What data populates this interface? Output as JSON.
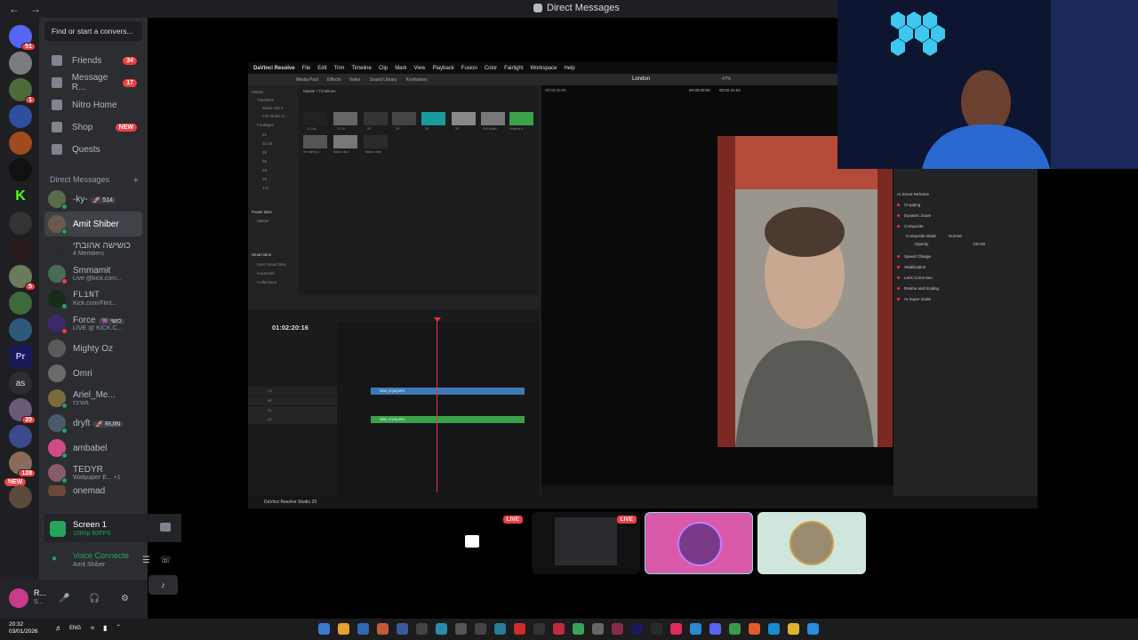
{
  "window": {
    "title": "Direct Messages"
  },
  "rail": {
    "badges": [
      "51",
      "1",
      "5",
      "20",
      "128"
    ],
    "labels": {
      "premiere": "Pr",
      "as": "as",
      "k": "K"
    },
    "new_label": "NEW"
  },
  "search": {
    "placeholder": "Find or start a convers..."
  },
  "nav": {
    "friends": {
      "label": "Friends",
      "count": "34"
    },
    "requests": {
      "label": "Message R...",
      "count": "17"
    },
    "nitro": {
      "label": "Nitro Home"
    },
    "shop": {
      "label": "Shop",
      "badge": "NEW"
    },
    "quests": {
      "label": "Quests"
    }
  },
  "dm_header": {
    "label": "Direct Messages",
    "add": "+"
  },
  "dms": [
    {
      "name": "-ky-",
      "tag": "🚀 514",
      "sub": ""
    },
    {
      "name": "Amit Shiber",
      "tag": "",
      "sub": ""
    },
    {
      "name": "כושישה אהובתי",
      "tag": "",
      "sub": "4 Members"
    },
    {
      "name": "Smmamit",
      "tag": "",
      "sub": "Live @kick.com..."
    },
    {
      "name": "FLiNT",
      "tag": "",
      "sub": "Kick.com/Flint..."
    },
    {
      "name": "Force",
      "tag": "👾 כושי",
      "sub": "LIVE @ KICK.C..."
    },
    {
      "name": "Mighty Oz",
      "tag": "",
      "sub": ""
    },
    {
      "name": "Omri",
      "tag": "",
      "sub": ""
    },
    {
      "name": "Ariel_Me...",
      "tag": "",
      "sub": "מגרבז"
    },
    {
      "name": "dryft",
      "tag": "🚀 RUIN",
      "sub": ""
    },
    {
      "name": "ambabel",
      "tag": "",
      "sub": ""
    },
    {
      "name": "TEDYR",
      "tag": "",
      "sub": "Wallpaper E...  +1"
    },
    {
      "name": "onemad",
      "tag": "",
      "sub": ""
    }
  ],
  "screen_share": {
    "title": "Screen 1",
    "quality": "1080p 60FPS"
  },
  "voice": {
    "status": "Voice Connecte",
    "channel": "Amit Shiber"
  },
  "user": {
    "name": "R...",
    "status": "S..."
  },
  "taskbar": {
    "time": "20:32",
    "date": "03/01/2026",
    "lang": "ENG"
  },
  "resolve": {
    "app_name": "DaVinci Resolve",
    "menu": [
      "File",
      "Edit",
      "Trim",
      "Timeline",
      "Clip",
      "Mark",
      "View",
      "Playback",
      "Fusion",
      "Color",
      "Fairlight",
      "Workspace",
      "Help"
    ],
    "toolbar": [
      "Media Pool",
      "Effects",
      "Index",
      "Sound Library",
      "Keyframes"
    ],
    "location": "London",
    "zoom": "47%",
    "timecode": "01:02:20:16",
    "viewer_tc_left": "00:00:00:00",
    "viewer_tc_mid": "00:00:00:00",
    "viewer_tc_right": "00:02:41:02",
    "bins": [
      "Master",
      "Timelines",
      "Music clip 1",
      "Full Music C...",
      "Footages",
      "21",
      "21-24",
      "25",
      "26",
      "28",
      "29",
      "1-3"
    ],
    "bins_extra": [
      "Power Bins",
      "Master",
      "Smart Bins",
      "User Smart Bins",
      "Keywords",
      "Collections"
    ],
    "pool_path": "Master / Timelines",
    "clips": [
      "21 Dec",
      "21 24",
      "25",
      "26",
      "28",
      "30",
      "Full Music",
      "Jump in c...",
      "me talking 1",
      "Music clip 1",
      "Music video"
    ],
    "tracks": [
      "V2",
      "V1",
      "A1",
      "A2"
    ],
    "clip_names": [
      "0530_07(28).MP4",
      "0530_07(28).MP4"
    ],
    "inspector": [
      "AI Smart Reframe",
      "Cropping",
      "Dynamic Zoom",
      "Composite",
      "Composite Mode",
      "Normal",
      "Opacity",
      "100.00",
      "Speed Change",
      "Stabilization",
      "Lens Correction",
      "Retime and Scaling",
      "AI Super Scale"
    ],
    "status": "DaVinci Resolve Studio 20"
  },
  "tiles": {
    "live_label": "LIVE"
  }
}
